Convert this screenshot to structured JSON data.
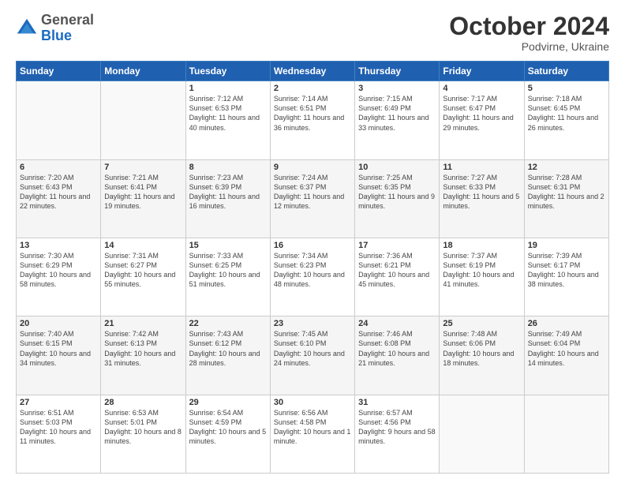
{
  "logo": {
    "general": "General",
    "blue": "Blue"
  },
  "header": {
    "month": "October 2024",
    "location": "Podvirne, Ukraine"
  },
  "weekdays": [
    "Sunday",
    "Monday",
    "Tuesday",
    "Wednesday",
    "Thursday",
    "Friday",
    "Saturday"
  ],
  "weeks": [
    [
      {
        "day": "",
        "sunrise": "",
        "sunset": "",
        "daylight": ""
      },
      {
        "day": "",
        "sunrise": "",
        "sunset": "",
        "daylight": ""
      },
      {
        "day": "1",
        "sunrise": "Sunrise: 7:12 AM",
        "sunset": "Sunset: 6:53 PM",
        "daylight": "Daylight: 11 hours and 40 minutes."
      },
      {
        "day": "2",
        "sunrise": "Sunrise: 7:14 AM",
        "sunset": "Sunset: 6:51 PM",
        "daylight": "Daylight: 11 hours and 36 minutes."
      },
      {
        "day": "3",
        "sunrise": "Sunrise: 7:15 AM",
        "sunset": "Sunset: 6:49 PM",
        "daylight": "Daylight: 11 hours and 33 minutes."
      },
      {
        "day": "4",
        "sunrise": "Sunrise: 7:17 AM",
        "sunset": "Sunset: 6:47 PM",
        "daylight": "Daylight: 11 hours and 29 minutes."
      },
      {
        "day": "5",
        "sunrise": "Sunrise: 7:18 AM",
        "sunset": "Sunset: 6:45 PM",
        "daylight": "Daylight: 11 hours and 26 minutes."
      }
    ],
    [
      {
        "day": "6",
        "sunrise": "Sunrise: 7:20 AM",
        "sunset": "Sunset: 6:43 PM",
        "daylight": "Daylight: 11 hours and 22 minutes."
      },
      {
        "day": "7",
        "sunrise": "Sunrise: 7:21 AM",
        "sunset": "Sunset: 6:41 PM",
        "daylight": "Daylight: 11 hours and 19 minutes."
      },
      {
        "day": "8",
        "sunrise": "Sunrise: 7:23 AM",
        "sunset": "Sunset: 6:39 PM",
        "daylight": "Daylight: 11 hours and 16 minutes."
      },
      {
        "day": "9",
        "sunrise": "Sunrise: 7:24 AM",
        "sunset": "Sunset: 6:37 PM",
        "daylight": "Daylight: 11 hours and 12 minutes."
      },
      {
        "day": "10",
        "sunrise": "Sunrise: 7:25 AM",
        "sunset": "Sunset: 6:35 PM",
        "daylight": "Daylight: 11 hours and 9 minutes."
      },
      {
        "day": "11",
        "sunrise": "Sunrise: 7:27 AM",
        "sunset": "Sunset: 6:33 PM",
        "daylight": "Daylight: 11 hours and 5 minutes."
      },
      {
        "day": "12",
        "sunrise": "Sunrise: 7:28 AM",
        "sunset": "Sunset: 6:31 PM",
        "daylight": "Daylight: 11 hours and 2 minutes."
      }
    ],
    [
      {
        "day": "13",
        "sunrise": "Sunrise: 7:30 AM",
        "sunset": "Sunset: 6:29 PM",
        "daylight": "Daylight: 10 hours and 58 minutes."
      },
      {
        "day": "14",
        "sunrise": "Sunrise: 7:31 AM",
        "sunset": "Sunset: 6:27 PM",
        "daylight": "Daylight: 10 hours and 55 minutes."
      },
      {
        "day": "15",
        "sunrise": "Sunrise: 7:33 AM",
        "sunset": "Sunset: 6:25 PM",
        "daylight": "Daylight: 10 hours and 51 minutes."
      },
      {
        "day": "16",
        "sunrise": "Sunrise: 7:34 AM",
        "sunset": "Sunset: 6:23 PM",
        "daylight": "Daylight: 10 hours and 48 minutes."
      },
      {
        "day": "17",
        "sunrise": "Sunrise: 7:36 AM",
        "sunset": "Sunset: 6:21 PM",
        "daylight": "Daylight: 10 hours and 45 minutes."
      },
      {
        "day": "18",
        "sunrise": "Sunrise: 7:37 AM",
        "sunset": "Sunset: 6:19 PM",
        "daylight": "Daylight: 10 hours and 41 minutes."
      },
      {
        "day": "19",
        "sunrise": "Sunrise: 7:39 AM",
        "sunset": "Sunset: 6:17 PM",
        "daylight": "Daylight: 10 hours and 38 minutes."
      }
    ],
    [
      {
        "day": "20",
        "sunrise": "Sunrise: 7:40 AM",
        "sunset": "Sunset: 6:15 PM",
        "daylight": "Daylight: 10 hours and 34 minutes."
      },
      {
        "day": "21",
        "sunrise": "Sunrise: 7:42 AM",
        "sunset": "Sunset: 6:13 PM",
        "daylight": "Daylight: 10 hours and 31 minutes."
      },
      {
        "day": "22",
        "sunrise": "Sunrise: 7:43 AM",
        "sunset": "Sunset: 6:12 PM",
        "daylight": "Daylight: 10 hours and 28 minutes."
      },
      {
        "day": "23",
        "sunrise": "Sunrise: 7:45 AM",
        "sunset": "Sunset: 6:10 PM",
        "daylight": "Daylight: 10 hours and 24 minutes."
      },
      {
        "day": "24",
        "sunrise": "Sunrise: 7:46 AM",
        "sunset": "Sunset: 6:08 PM",
        "daylight": "Daylight: 10 hours and 21 minutes."
      },
      {
        "day": "25",
        "sunrise": "Sunrise: 7:48 AM",
        "sunset": "Sunset: 6:06 PM",
        "daylight": "Daylight: 10 hours and 18 minutes."
      },
      {
        "day": "26",
        "sunrise": "Sunrise: 7:49 AM",
        "sunset": "Sunset: 6:04 PM",
        "daylight": "Daylight: 10 hours and 14 minutes."
      }
    ],
    [
      {
        "day": "27",
        "sunrise": "Sunrise: 6:51 AM",
        "sunset": "Sunset: 5:03 PM",
        "daylight": "Daylight: 10 hours and 11 minutes."
      },
      {
        "day": "28",
        "sunrise": "Sunrise: 6:53 AM",
        "sunset": "Sunset: 5:01 PM",
        "daylight": "Daylight: 10 hours and 8 minutes."
      },
      {
        "day": "29",
        "sunrise": "Sunrise: 6:54 AM",
        "sunset": "Sunset: 4:59 PM",
        "daylight": "Daylight: 10 hours and 5 minutes."
      },
      {
        "day": "30",
        "sunrise": "Sunrise: 6:56 AM",
        "sunset": "Sunset: 4:58 PM",
        "daylight": "Daylight: 10 hours and 1 minute."
      },
      {
        "day": "31",
        "sunrise": "Sunrise: 6:57 AM",
        "sunset": "Sunset: 4:56 PM",
        "daylight": "Daylight: 9 hours and 58 minutes."
      },
      {
        "day": "",
        "sunrise": "",
        "sunset": "",
        "daylight": ""
      },
      {
        "day": "",
        "sunrise": "",
        "sunset": "",
        "daylight": ""
      }
    ]
  ]
}
